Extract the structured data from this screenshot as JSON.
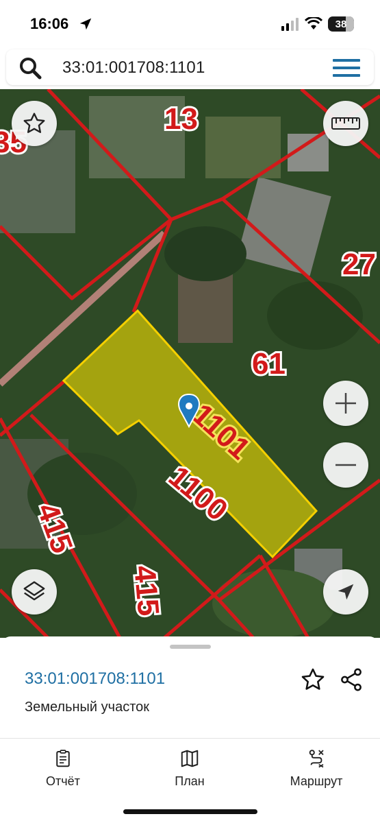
{
  "status_bar": {
    "time": "16:06",
    "battery": "38"
  },
  "search": {
    "query": "33:01:001708:1101"
  },
  "map": {
    "parcel_labels": {
      "p13": "13",
      "p35": "35",
      "p27": "27",
      "p61": "61",
      "p1101": "1101",
      "p1100": "1100",
      "p415a": "415",
      "p415b": "415"
    },
    "colors": {
      "boundary": "#d21a1a",
      "selected_fill": "#c9c20f",
      "selected_border": "#f5d000"
    }
  },
  "sheet": {
    "parcel_id": "33:01:001708:1101",
    "parcel_type": "Земельный участок"
  },
  "nav": {
    "report": "Отчёт",
    "plan": "План",
    "route": "Маршрут"
  }
}
